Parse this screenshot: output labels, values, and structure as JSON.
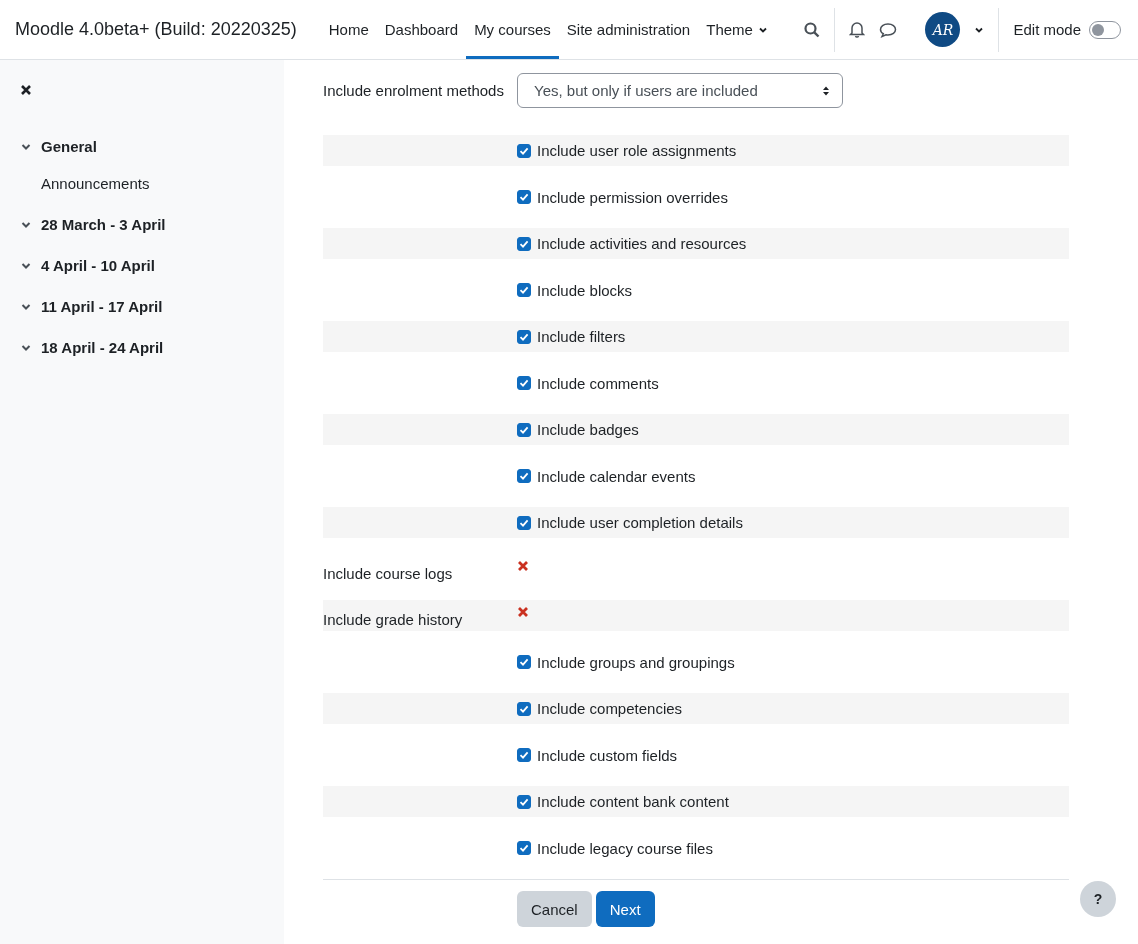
{
  "header": {
    "site_name": "Moodle 4.0beta+ (Build: 20220325)",
    "nav": [
      {
        "label": "Home",
        "selected": false,
        "dropdown": false
      },
      {
        "label": "Dashboard",
        "selected": false,
        "dropdown": false
      },
      {
        "label": "My courses",
        "selected": true,
        "dropdown": false
      },
      {
        "label": "Site administration",
        "selected": false,
        "dropdown": false
      },
      {
        "label": "Theme",
        "selected": false,
        "dropdown": true
      }
    ],
    "avatar_initials": "AR",
    "edit_mode": {
      "label": "Edit mode",
      "on": false
    }
  },
  "sidebar": {
    "sections": [
      {
        "label": "General",
        "expanded": true,
        "children": [
          {
            "label": "Announcements"
          }
        ]
      },
      {
        "label": "28 March - 3 April",
        "expanded": true
      },
      {
        "label": "4 April - 10 April",
        "expanded": true
      },
      {
        "label": "11 April - 17 April",
        "expanded": true
      },
      {
        "label": "18 April - 24 April",
        "expanded": true
      }
    ]
  },
  "form": {
    "select": {
      "label": "Include enrolment methods",
      "value": "Yes, but only if users are included"
    },
    "settings": [
      {
        "kind": "checkbox",
        "label": "Include user role assignments",
        "checked": true
      },
      {
        "kind": "checkbox",
        "label": "Include permission overrides",
        "checked": true
      },
      {
        "kind": "checkbox",
        "label": "Include activities and resources",
        "checked": true
      },
      {
        "kind": "checkbox",
        "label": "Include blocks",
        "checked": true
      },
      {
        "kind": "checkbox",
        "label": "Include filters",
        "checked": true
      },
      {
        "kind": "checkbox",
        "label": "Include comments",
        "checked": true
      },
      {
        "kind": "checkbox",
        "label": "Include badges",
        "checked": true
      },
      {
        "kind": "checkbox",
        "label": "Include calendar events",
        "checked": true
      },
      {
        "kind": "checkbox",
        "label": "Include user completion details",
        "checked": true
      },
      {
        "kind": "locked",
        "label": "Include course logs"
      },
      {
        "kind": "locked",
        "label": "Include grade history"
      },
      {
        "kind": "checkbox",
        "label": "Include groups and groupings",
        "checked": true
      },
      {
        "kind": "checkbox",
        "label": "Include competencies",
        "checked": true
      },
      {
        "kind": "checkbox",
        "label": "Include custom fields",
        "checked": true
      },
      {
        "kind": "checkbox",
        "label": "Include content bank content",
        "checked": true
      },
      {
        "kind": "checkbox",
        "label": "Include legacy course files",
        "checked": true
      }
    ],
    "buttons": [
      {
        "label": "Cancel",
        "kind": "secondary"
      },
      {
        "label": "Next",
        "kind": "primary"
      }
    ]
  },
  "help_button": "?"
}
